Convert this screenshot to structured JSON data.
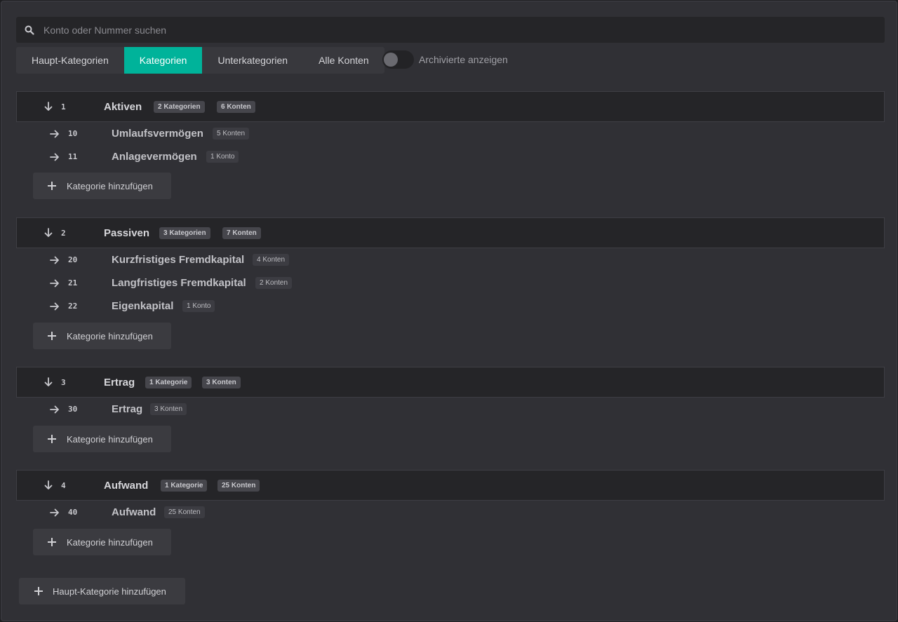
{
  "search": {
    "placeholder": "Konto oder Nummer suchen"
  },
  "tabs": [
    {
      "label": "Haupt-Kategorien",
      "active": false
    },
    {
      "label": "Kategorien",
      "active": true
    },
    {
      "label": "Unterkategorien",
      "active": false
    },
    {
      "label": "Alle Konten",
      "active": false
    }
  ],
  "toggle": {
    "label": "Archivierte anzeigen",
    "on": false
  },
  "groups": [
    {
      "number": "1",
      "title": "Aktiven",
      "badge_categories": "2 Kategorien",
      "badge_accounts": "6 Konten",
      "items": [
        {
          "number": "10",
          "title": "Umlaufsvermögen",
          "badge": "5 Konten"
        },
        {
          "number": "11",
          "title": "Anlagevermögen",
          "badge": "1 Konto"
        }
      ]
    },
    {
      "number": "2",
      "title": "Passiven",
      "badge_categories": "3 Kategorien",
      "badge_accounts": "7 Konten",
      "items": [
        {
          "number": "20",
          "title": "Kurzfristiges Fremdkapital",
          "badge": "4 Konten"
        },
        {
          "number": "21",
          "title": "Langfristiges Fremdkapital",
          "badge": "2 Konten"
        },
        {
          "number": "22",
          "title": "Eigenkapital",
          "badge": "1 Konto"
        }
      ]
    },
    {
      "number": "3",
      "title": "Ertrag",
      "badge_categories": "1 Kategorie",
      "badge_accounts": "3 Konten",
      "items": [
        {
          "number": "30",
          "title": "Ertrag",
          "badge": "3 Konten"
        }
      ]
    },
    {
      "number": "4",
      "title": "Aufwand",
      "badge_categories": "1 Kategorie",
      "badge_accounts": "25 Konten",
      "items": [
        {
          "number": "40",
          "title": "Aufwand",
          "badge": "25 Konten"
        }
      ]
    }
  ],
  "add_category_label": "Kategorie hinzufügen",
  "add_main_category_label": "Haupt-Kategorie hinzufügen",
  "colors": {
    "accent": "#00b39a",
    "background": "#303035",
    "header": "#252528"
  }
}
